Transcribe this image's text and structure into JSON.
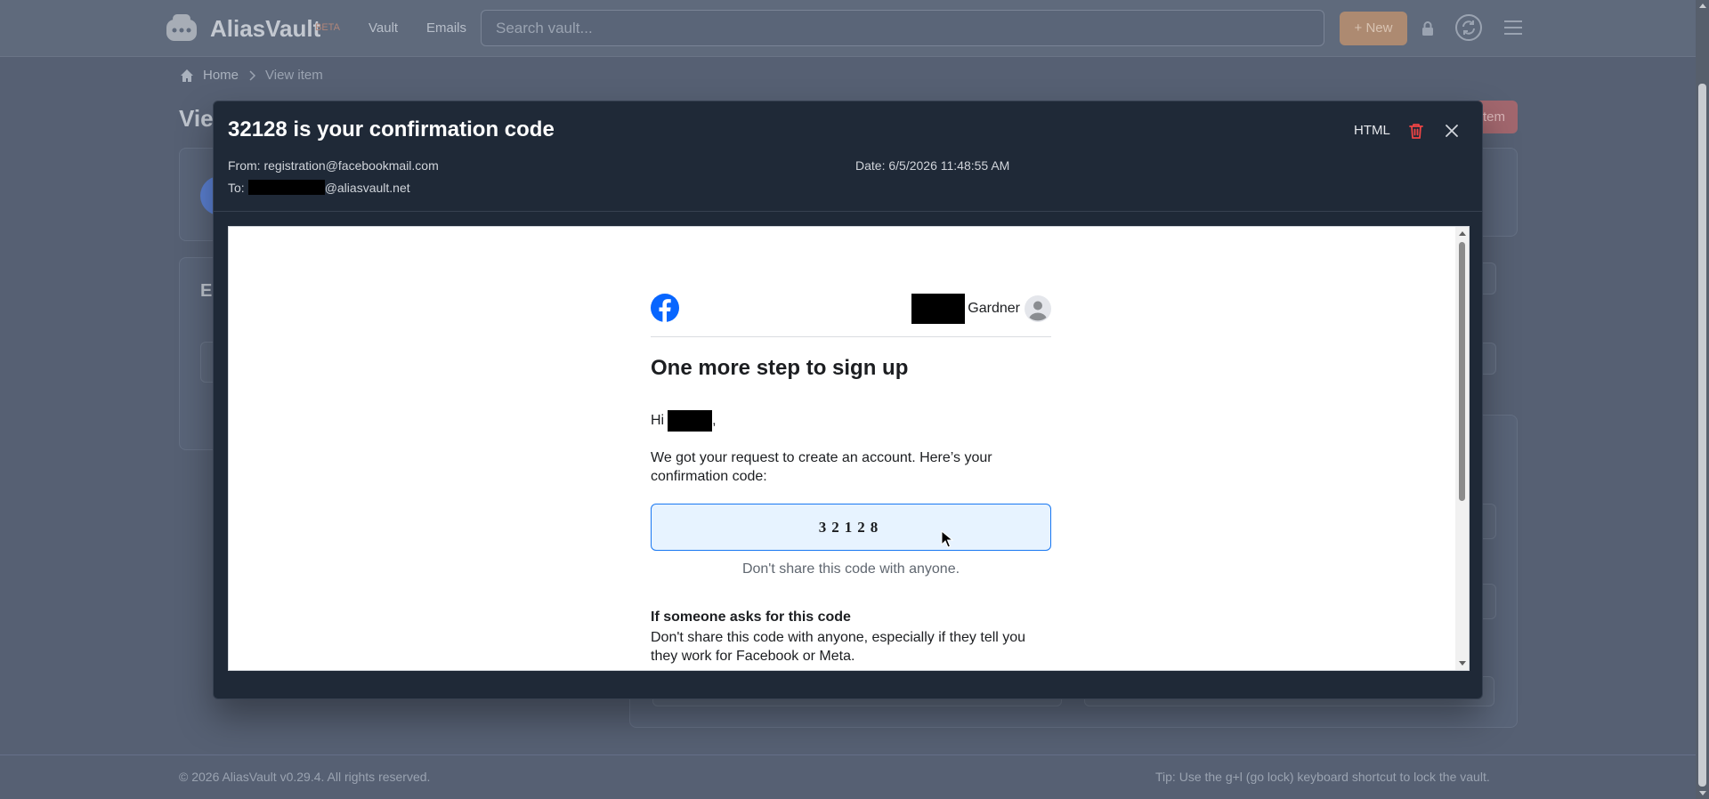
{
  "app": {
    "brand": "AliasVault",
    "beta": "BETA",
    "nav": [
      "Vault",
      "Emails"
    ],
    "search_placeholder": "Search vault...",
    "new_button": "+ New"
  },
  "breadcrumb": {
    "home": "Home",
    "current": "View item"
  },
  "page": {
    "title_partial": "Vie",
    "delete_partial": "tem",
    "card_letter": "E"
  },
  "footer": {
    "copyright": "© 2026 AliasVault v0.29.4. All rights reserved.",
    "tip": "Tip: Use the g+l (go lock) keyboard shortcut to lock the vault."
  },
  "modal": {
    "subject": "32128 is your confirmation code",
    "from_label": "From:",
    "from": "registration@facebookmail.com",
    "to_label": "To:",
    "to_domain": "@aliasvault.net",
    "date_label": "Date:",
    "date": "6/5/2026 11:48:55 AM",
    "html_toggle": "HTML"
  },
  "email": {
    "user_last_name": "Gardner",
    "heading": "One more step to sign up",
    "greeting": "Hi",
    "greeting_punct": ",",
    "body": "We got your request to create an account. Here’s your confirmation code:",
    "code": "32128",
    "code_note": "Don't share this code with anyone.",
    "subheading": "If someone asks for this code",
    "warning": "Don't share this code with anyone, especially if they tell you they work for Facebook or Meta."
  },
  "colors": {
    "modal_bg": "#1f2937",
    "code_border": "#1877f2",
    "code_bg": "#e7f3ff",
    "facebook_blue": "#0866ff",
    "danger": "#ef4444"
  },
  "icons": [
    "aliasvault-logo-icon",
    "lock-icon",
    "sync-icon",
    "menu-icon",
    "home-icon",
    "chevron-right-icon",
    "trash-icon",
    "close-icon",
    "facebook-logo-icon",
    "user-avatar-icon",
    "mouse-cursor-icon"
  ]
}
